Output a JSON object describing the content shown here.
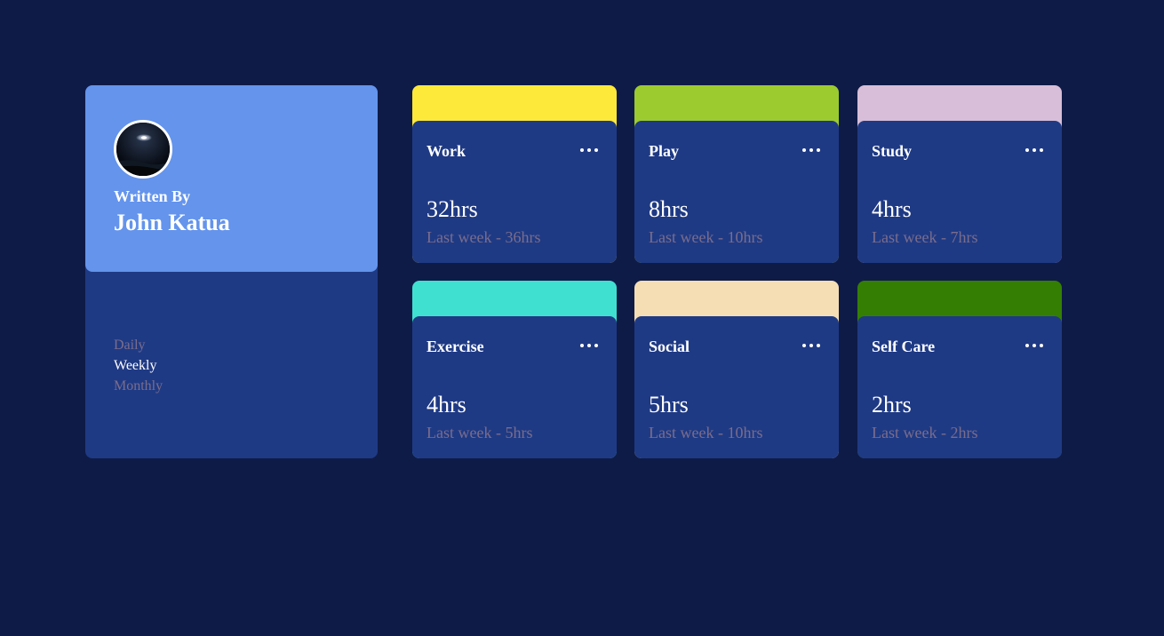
{
  "profile": {
    "written_by": "Written By",
    "name": "John Katua",
    "avatar_icon": "night-sky-avatar"
  },
  "periods": [
    {
      "label": "Daily",
      "active": false
    },
    {
      "label": "Weekly",
      "active": true
    },
    {
      "label": "Monthly",
      "active": false
    }
  ],
  "menu_icon": "ellipsis-icon",
  "cards": [
    {
      "title": "Work",
      "current": "32hrs",
      "previous": "Last week - 36hrs",
      "color": "#fde93a"
    },
    {
      "title": "Play",
      "current": "8hrs",
      "previous": "Last week - 10hrs",
      "color": "#9ccb2f"
    },
    {
      "title": "Study",
      "current": "4hrs",
      "previous": "Last week - 7hrs",
      "color": "#d8bed8"
    },
    {
      "title": "Exercise",
      "current": "4hrs",
      "previous": "Last week - 5hrs",
      "color": "#40e0d0"
    },
    {
      "title": "Social",
      "current": "5hrs",
      "previous": "Last week - 10hrs",
      "color": "#f5deb3"
    },
    {
      "title": "Self Care",
      "current": "2hrs",
      "previous": "Last week - 2hrs",
      "color": "#347f03"
    }
  ],
  "colors": {
    "page_background": "#0f1b47",
    "card_background": "#1f3a84",
    "profile_accent": "#6494ec",
    "muted_text": "#7a6d8c",
    "active_text": "#ffffff"
  }
}
